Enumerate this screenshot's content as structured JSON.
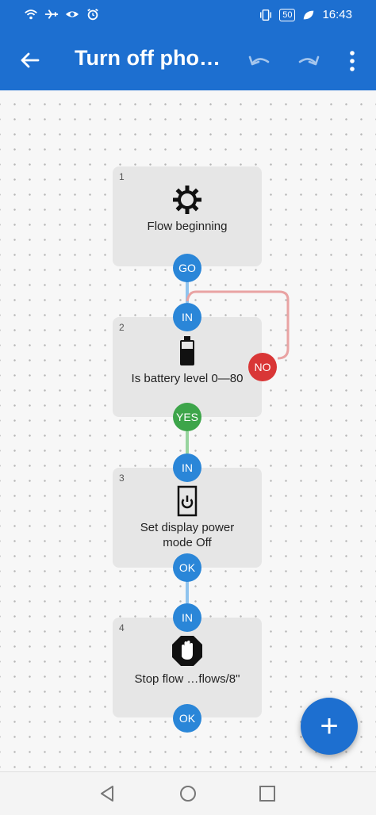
{
  "status_bar": {
    "icons": [
      "wifi-icon",
      "airplane-icon",
      "eye-icon",
      "alarm-icon",
      "vibrate-icon",
      "leaf-icon"
    ],
    "battery": "50",
    "time": "16:43"
  },
  "app_bar": {
    "title": "Turn off pho…",
    "icons": [
      "back-arrow-icon",
      "undo-icon",
      "redo-icon",
      "more-vert-icon"
    ]
  },
  "flow": {
    "steps": [
      {
        "number": "1",
        "icon": "gear-icon",
        "label": "Flow beginning",
        "ports": {
          "out": "GO"
        }
      },
      {
        "number": "2",
        "icon": "battery-icon",
        "label": "Is battery level 0—80",
        "ports": {
          "in": "IN",
          "yes": "YES",
          "no": "NO"
        }
      },
      {
        "number": "3",
        "icon": "power-button-icon",
        "label_line1": "Set display power",
        "label_line2": "mode Off",
        "ports": {
          "in": "IN",
          "out": "OK"
        }
      },
      {
        "number": "4",
        "icon": "stop-hand-icon",
        "label": "Stop flow …flows/8\"",
        "ports": {
          "in": "IN",
          "out": "OK"
        }
      }
    ]
  },
  "fab": {
    "label": "+"
  },
  "nav_bar": {
    "icons": [
      "back-triangle-icon",
      "home-circle-icon",
      "recents-square-icon"
    ]
  },
  "colors": {
    "primary": "#1d6fd0",
    "port_blue": "#2a86d8",
    "port_green": "#3da54a",
    "port_red": "#d93636"
  }
}
